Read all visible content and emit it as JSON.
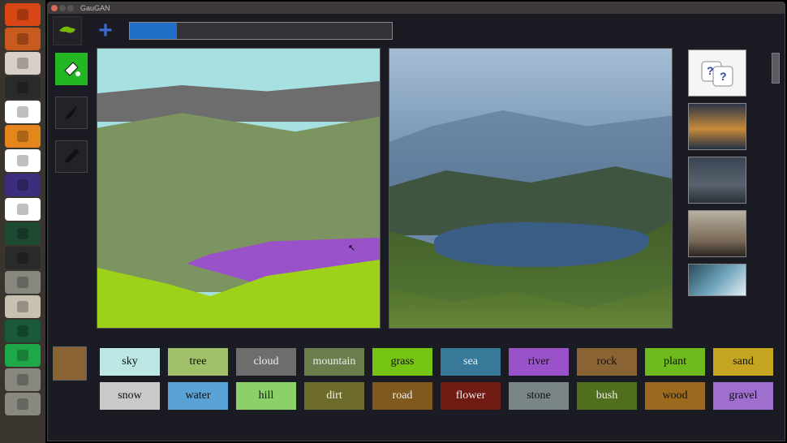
{
  "titlebar": {
    "dot_close_color": "#d46a5a",
    "dot_min_color": "#555",
    "dot_max_color": "#555",
    "app_name": "GauGAN"
  },
  "topbar": {
    "nvidia_accent": "#76b900",
    "plus_glyph": "+",
    "progress_percent": 18
  },
  "tools": {
    "bucket_active": true,
    "brush": "brush",
    "pencil": "pencil"
  },
  "style_thumbs": {
    "dice_bg": "#f5f5f5",
    "dice_accent": "#2b4aa0"
  },
  "segmap_colors": {
    "sky": "#a7e0e0",
    "mountain": "#6d6d6d",
    "hill": "#7b9460",
    "river": "#9a52c9",
    "grass": "#9dd218"
  },
  "current_swatch": "#8a6335",
  "palette": [
    [
      {
        "label": "sky",
        "bg": "#bde7e4"
      },
      {
        "label": "tree",
        "bg": "#a1c06a"
      },
      {
        "label": "cloud",
        "bg": "#6d6d6d",
        "dark": true
      },
      {
        "label": "mountain",
        "bg": "#6b7c4d",
        "dark": true
      },
      {
        "label": "grass",
        "bg": "#76c414"
      },
      {
        "label": "sea",
        "bg": "#38799a",
        "dark": true
      },
      {
        "label": "river",
        "bg": "#9a52c9"
      },
      {
        "label": "rock",
        "bg": "#8a6335"
      },
      {
        "label": "plant",
        "bg": "#6fbb1e"
      },
      {
        "label": "sand",
        "bg": "#c5a51f"
      }
    ],
    [
      {
        "label": "snow",
        "bg": "#c9c9c9"
      },
      {
        "label": "water",
        "bg": "#5aa1d6"
      },
      {
        "label": "hill",
        "bg": "#8cd06a"
      },
      {
        "label": "dirt",
        "bg": "#6e6c2c",
        "dark": true
      },
      {
        "label": "road",
        "bg": "#80591f",
        "dark": true
      },
      {
        "label": "flower",
        "bg": "#6f1a13",
        "dark": true
      },
      {
        "label": "stone",
        "bg": "#7a8585"
      },
      {
        "label": "bush",
        "bg": "#4f6e1e",
        "dark": true
      },
      {
        "label": "wood",
        "bg": "#9c6a1e"
      },
      {
        "label": "gravel",
        "bg": "#9f6fd0"
      }
    ]
  ],
  "ubuntu_taskbar": [
    {
      "name": "ubuntu-dash",
      "bg": "#d84615"
    },
    {
      "name": "files",
      "bg": "#c8591f"
    },
    {
      "name": "settings",
      "bg": "#d8d0c8"
    },
    {
      "name": "terminal",
      "bg": "#2a2a2a"
    },
    {
      "name": "chrome",
      "bg": "#ffffff"
    },
    {
      "name": "sublime",
      "bg": "#e3871c"
    },
    {
      "name": "slack",
      "bg": "#ffffff"
    },
    {
      "name": "tex",
      "bg": "#3d2e7d"
    },
    {
      "name": "font-func",
      "bg": "#ffffff"
    },
    {
      "name": "globe",
      "bg": "#1e4a34"
    },
    {
      "name": "brush-app",
      "bg": "#2a2a2a"
    },
    {
      "name": "unknown-app",
      "bg": "#888880"
    },
    {
      "name": "files2",
      "bg": "#c8c0b0"
    },
    {
      "name": "green-app",
      "bg": "#1a5a3a"
    },
    {
      "name": "pycharm",
      "bg": "#1fa84a"
    },
    {
      "name": "help",
      "bg": "#888880"
    },
    {
      "name": "show-apps",
      "bg": "#888880"
    }
  ]
}
